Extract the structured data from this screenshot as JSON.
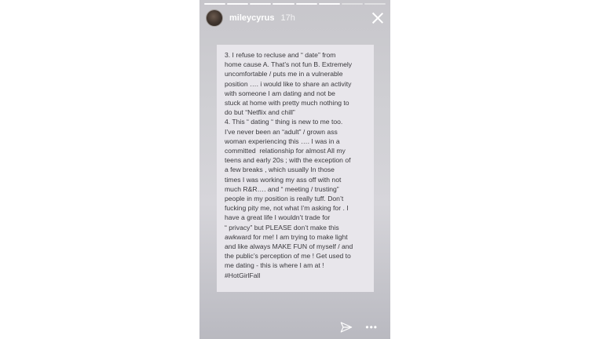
{
  "story": {
    "username": "mileycyrus",
    "time_ago": "17h",
    "progress_segments": [
      true,
      true,
      true,
      true,
      true,
      true,
      false,
      false
    ],
    "text": "3. I refuse to recluse and “ date” from\nhome cause A. That’s not fun B. Extremely\nuncomfortable / puts me in a vulnerable\nposition …. i would like to share an activity\nwith someone I am dating and not be\nstuck at home with pretty much nothing to\ndo but “Netflix and chill”\n4. This “ dating “ thing is new to me too.\nI’ve never been an “adult” / grown ass\nwoman experiencing this …. I was in a\ncommitted  relationship for almost All my\nteens and early 20s ; with the exception of\na few breaks , which usually In those\ntimes I was working my ass off with not\nmuch R&R…. and “ meeting / trusting”\npeople in my position is really tuff. Don’t\nfucking pity me, not what I’m asking for . I\nhave a great life I wouldn’t trade for\n“ privacy” but PLEASE don’t make this\nawkward for me! I am trying to make light\nand like always MAKE FUN of myself / and\nthe public’s perception of me ! Get used to\nme dating - this is where I am at !\n#HotGirlFall",
    "icons": {
      "avatar": "avatar",
      "close": "close-icon",
      "share": "send-icon",
      "more": "more-icon"
    },
    "colors": {
      "background": "#cfcfd3",
      "note_background": "#e8e6eb",
      "text": "#3a393d"
    }
  }
}
